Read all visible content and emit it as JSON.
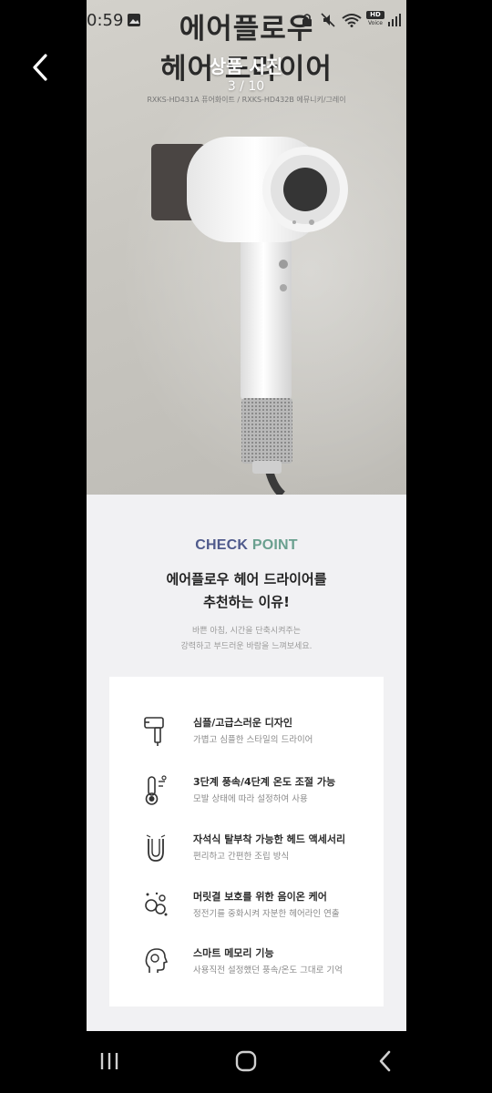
{
  "status_bar": {
    "time": "0:59",
    "network_badge_top": "HD",
    "network_badge_bottom": "Voice"
  },
  "header": {
    "title": "상품 사진",
    "counter": "3 / 10"
  },
  "product": {
    "headline_line1": "에어플로우",
    "headline_line2": "헤어 드라이어",
    "model_line": "RXKS-HD431A 퓨어화이트 / RXKS-HD432B 에뮤니키/그레이"
  },
  "checkpoint": {
    "label_part1": "CHECK",
    "label_part2": "POINT",
    "reason_line1": "에어플로우 헤어 드라이어를",
    "reason_line2": "추천하는 이유!",
    "desc_line1": "바쁜 아침, 시간을 단축시켜주는",
    "desc_line2": "강력하고 부드러운 바람을 느껴보세요."
  },
  "features": [
    {
      "icon": "hair-dryer-icon",
      "title": "심플/고급스러운 디자인",
      "subtitle": "가볍고 심플한 스타일의 드라이어"
    },
    {
      "icon": "thermometer-icon",
      "title": "3단계 풍속/4단계 온도 조절 가능",
      "subtitle": "모발 상태에 따라 설정하여 사용"
    },
    {
      "icon": "magnet-icon",
      "title": "자석식 탈부착 가능한 헤드 액세서리",
      "subtitle": "편리하고 간편한 조립 방식"
    },
    {
      "icon": "ion-icon",
      "title": "머릿결 보호를 위한 음이온 케어",
      "subtitle": "정전기를 중화시켜 자분한 헤어라인 연출"
    },
    {
      "icon": "memory-head-icon",
      "title": "스마트 메모리 기능",
      "subtitle": "사용직전 설정했던 풍속/온도 그대로 기억"
    }
  ],
  "colors": {
    "checkpoint_blue": "#4f5a8c",
    "checkpoint_green": "#6aa08f",
    "background": "#000000"
  }
}
